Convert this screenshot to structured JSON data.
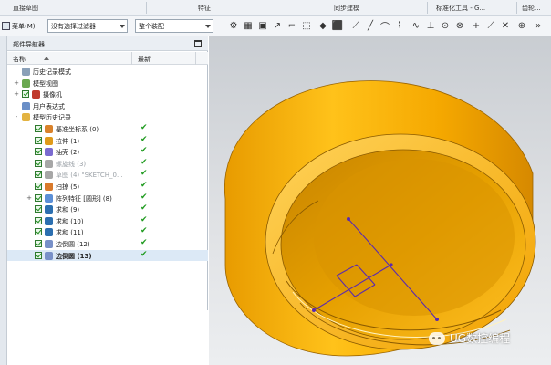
{
  "ribbon": {
    "groups": [
      "直接草图",
      "特征",
      "同步建模",
      "标准化工具 - G...",
      "齿轮..."
    ]
  },
  "toolbar": {
    "menu_label": "菜单(M)",
    "filter_combo": "没有选择过滤器",
    "scope_combo": "整个装配"
  },
  "navigator": {
    "title": "部件导航器",
    "col_name": "名称",
    "col_latest": "最新",
    "rows": [
      {
        "label": "历史记录模式",
        "indent": 0,
        "expander": "",
        "checkbox": false,
        "icon": "clock-icon",
        "latest": false,
        "style": ""
      },
      {
        "label": "模型视图",
        "indent": 0,
        "expander": "+",
        "checkbox": false,
        "icon": "model-views-icon",
        "latest": false,
        "style": ""
      },
      {
        "label": "摄像机",
        "indent": 0,
        "expander": "+",
        "checkbox": true,
        "icon": "camera-icon",
        "latest": false,
        "style": ""
      },
      {
        "label": "用户表达式",
        "indent": 0,
        "expander": "",
        "checkbox": false,
        "icon": "expression-icon",
        "latest": false,
        "style": ""
      },
      {
        "label": "模型历史记录",
        "indent": 0,
        "expander": "-",
        "checkbox": false,
        "icon": "folder-icon",
        "latest": false,
        "style": ""
      },
      {
        "label": "基准坐标系 (0)",
        "indent": 1,
        "expander": "",
        "checkbox": true,
        "icon": "datum-csys-icon",
        "latest": true,
        "style": ""
      },
      {
        "label": "拉伸 (1)",
        "indent": 1,
        "expander": "",
        "checkbox": true,
        "icon": "extrude-icon",
        "latest": true,
        "style": ""
      },
      {
        "label": "抽壳 (2)",
        "indent": 1,
        "expander": "",
        "checkbox": true,
        "icon": "shell-icon",
        "latest": true,
        "style": ""
      },
      {
        "label": "螺旋线 (3)",
        "indent": 1,
        "expander": "",
        "checkbox": true,
        "icon": "helix-icon",
        "latest": true,
        "style": "dim"
      },
      {
        "label": "草图 (4) \"SKETCH_0...",
        "indent": 1,
        "expander": "",
        "checkbox": true,
        "icon": "sketch-icon",
        "latest": true,
        "style": "dim"
      },
      {
        "label": "扫掠 (5)",
        "indent": 1,
        "expander": "",
        "checkbox": true,
        "icon": "sweep-icon",
        "latest": true,
        "style": ""
      },
      {
        "label": "阵列特征 [圆形] (8)",
        "indent": 1,
        "expander": "+",
        "checkbox": true,
        "icon": "pattern-icon",
        "latest": true,
        "style": ""
      },
      {
        "label": "求和 (9)",
        "indent": 1,
        "expander": "",
        "checkbox": true,
        "icon": "unite-icon",
        "latest": true,
        "style": ""
      },
      {
        "label": "求和 (10)",
        "indent": 1,
        "expander": "",
        "checkbox": true,
        "icon": "unite-icon",
        "latest": true,
        "style": ""
      },
      {
        "label": "求和 (11)",
        "indent": 1,
        "expander": "",
        "checkbox": true,
        "icon": "unite-icon",
        "latest": true,
        "style": ""
      },
      {
        "label": "边倒圆 (12)",
        "indent": 1,
        "expander": "",
        "checkbox": true,
        "icon": "edge-blend-icon",
        "latest": true,
        "style": ""
      },
      {
        "label": "边倒圆 (13)",
        "indent": 1,
        "expander": "",
        "checkbox": true,
        "icon": "edge-blend-icon",
        "latest": true,
        "style": "bold sel"
      }
    ]
  },
  "watermark": {
    "text": "UG数控编程"
  },
  "colors": {
    "part_orange": "#f5a500",
    "part_dark": "#c97e00",
    "sketch_line": "#5a2ab0",
    "check_green": "#1e9a1e"
  }
}
